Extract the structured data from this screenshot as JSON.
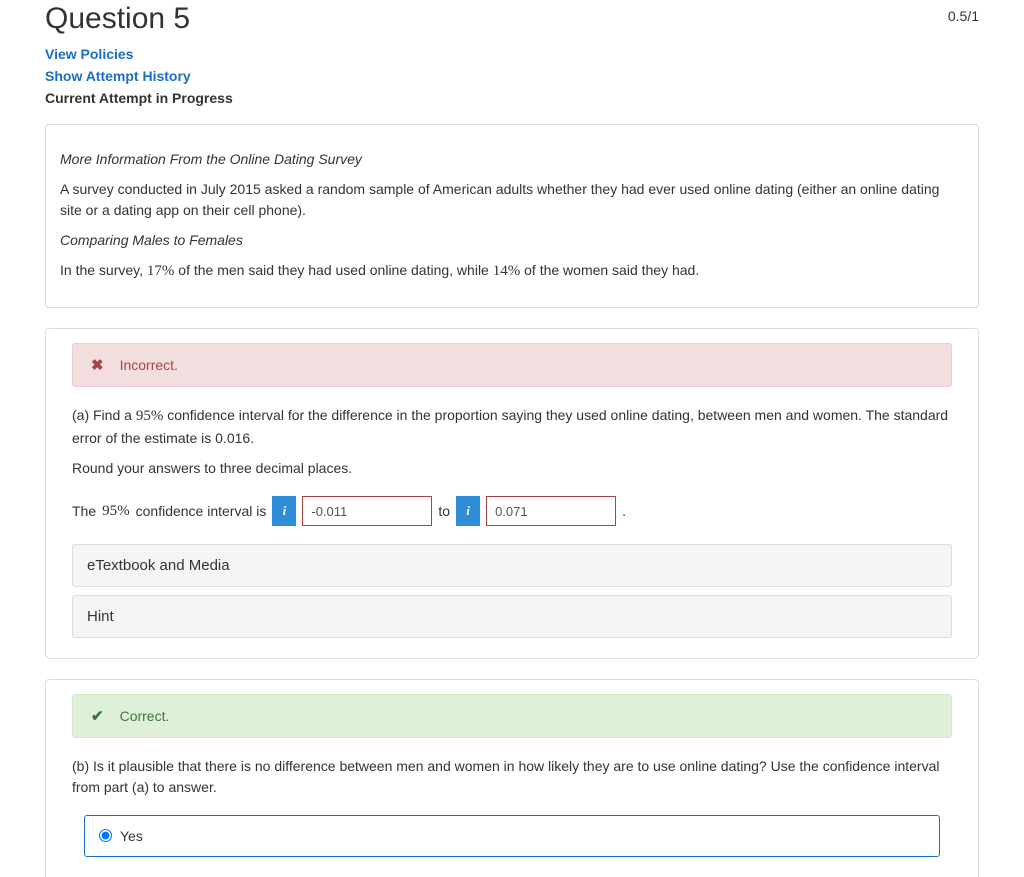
{
  "header": {
    "title": "Question 5",
    "score": "0.5/1"
  },
  "links": {
    "view_policies": "View Policies",
    "show_history": "Show Attempt History"
  },
  "current_attempt": "Current Attempt in Progress",
  "context": {
    "heading1": "More Information From the Online Dating Survey",
    "para1": "A survey conducted in July 2015 asked a random sample of American adults whether they had ever used online dating (either an online dating site or a dating app on their cell phone).",
    "heading2": "Comparing Males to Females",
    "para2_prefix": "In the survey, ",
    "pct_men": "17%",
    "para2_mid": " of the men said they had used online dating, while ",
    "pct_women": "14%",
    "para2_suffix": " of the women said they had."
  },
  "part_a": {
    "feedback_label": "Incorrect.",
    "prompt_prefix": "(a) Find a ",
    "ci_level": "95%",
    "prompt_suffix": " confidence interval for the difference in the proportion saying they used online dating, between men and women. The standard error of the estimate is 0.016.",
    "round_note": "Round your answers to three decimal places.",
    "answer_prefix": "The ",
    "answer_mid1": " confidence interval is",
    "to_word": "to",
    "period": ".",
    "input_lower": "-0.011",
    "input_upper": "0.071",
    "expanders": {
      "etext": "eTextbook and Media",
      "hint": "Hint"
    }
  },
  "part_b": {
    "feedback_label": "Correct.",
    "prompt": "(b) Is it plausible that there is no difference between men and women in how likely they are to use online dating? Use the confidence interval from part (a) to answer.",
    "option_yes": "Yes"
  },
  "icons": {
    "info": "i",
    "x": "✖",
    "check": "✔"
  }
}
